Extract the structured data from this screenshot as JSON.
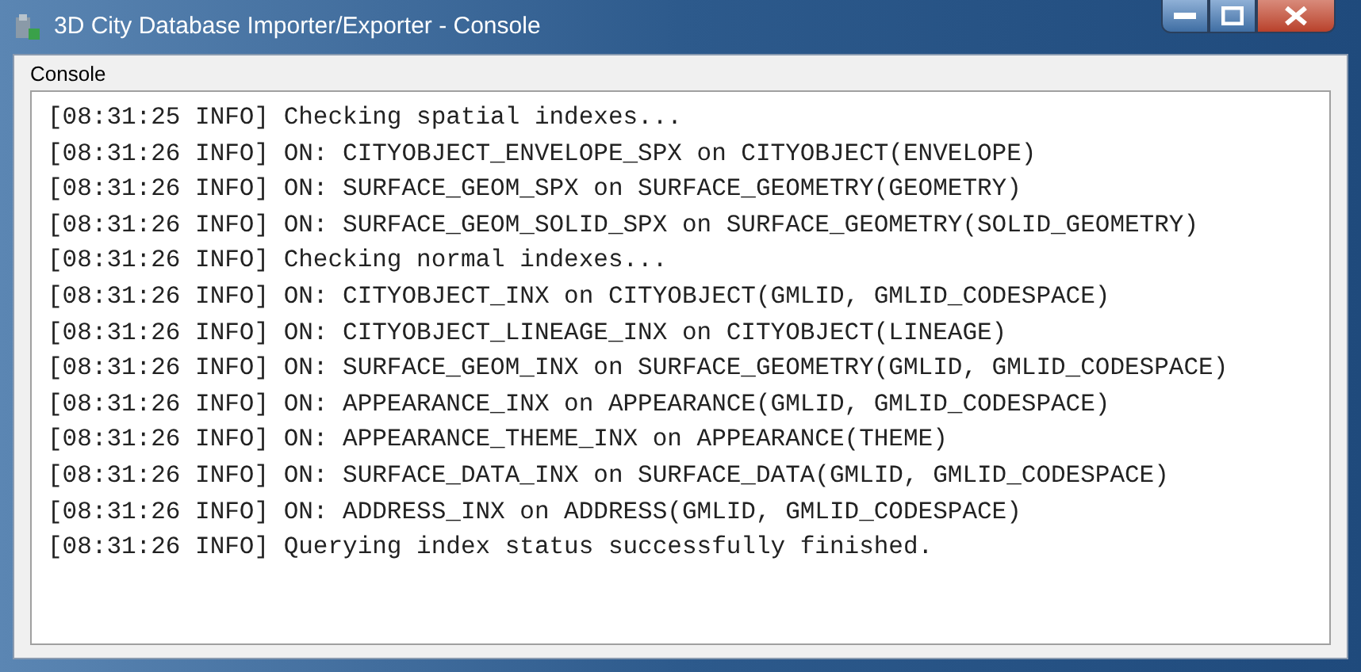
{
  "window": {
    "title": "3D City Database Importer/Exporter - Console",
    "buttons": [
      {
        "kind": "minimize"
      },
      {
        "kind": "maximize"
      },
      {
        "kind": "close"
      }
    ]
  },
  "panel": {
    "title": "Console"
  },
  "console": {
    "lines": [
      "[08:31:25 INFO] Checking spatial indexes...",
      "[08:31:26 INFO] ON: CITYOBJECT_ENVELOPE_SPX on CITYOBJECT(ENVELOPE)",
      "[08:31:26 INFO] ON: SURFACE_GEOM_SPX on SURFACE_GEOMETRY(GEOMETRY)",
      "[08:31:26 INFO] ON: SURFACE_GEOM_SOLID_SPX on SURFACE_GEOMETRY(SOLID_GEOMETRY)",
      "[08:31:26 INFO] Checking normal indexes...",
      "[08:31:26 INFO] ON: CITYOBJECT_INX on CITYOBJECT(GMLID, GMLID_CODESPACE)",
      "[08:31:26 INFO] ON: CITYOBJECT_LINEAGE_INX on CITYOBJECT(LINEAGE)",
      "[08:31:26 INFO] ON: SURFACE_GEOM_INX on SURFACE_GEOMETRY(GMLID, GMLID_CODESPACE)",
      "[08:31:26 INFO] ON: APPEARANCE_INX on APPEARANCE(GMLID, GMLID_CODESPACE)",
      "[08:31:26 INFO] ON: APPEARANCE_THEME_INX on APPEARANCE(THEME)",
      "[08:31:26 INFO] ON: SURFACE_DATA_INX on SURFACE_DATA(GMLID, GMLID_CODESPACE)",
      "[08:31:26 INFO] ON: ADDRESS_INX on ADDRESS(GMLID, GMLID_CODESPACE)",
      "[08:31:26 INFO] Querying index status successfully finished."
    ]
  }
}
